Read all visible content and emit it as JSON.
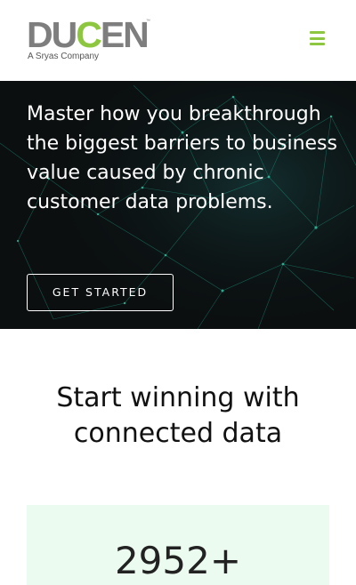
{
  "brand": {
    "logo_prefix": "DU",
    "logo_accent": "C",
    "logo_suffix": "EN",
    "trademark": "™",
    "tagline": "A Sryas Company",
    "accent_color": "#8dc63f",
    "logo_gray": "#7e7e7e"
  },
  "nav": {
    "menu_icon": "hamburger-menu-icon"
  },
  "hero": {
    "headline": "Master how you breakthrough the biggest barriers to business value caused by chronic customer data problems.",
    "cta_label": "GET STARTED",
    "background": "#0b0f10",
    "network_color": "#1fa58c"
  },
  "stats_section": {
    "title": "Start winning with connected data",
    "card_background": "#ebfbef",
    "stat_value": "2952+"
  }
}
